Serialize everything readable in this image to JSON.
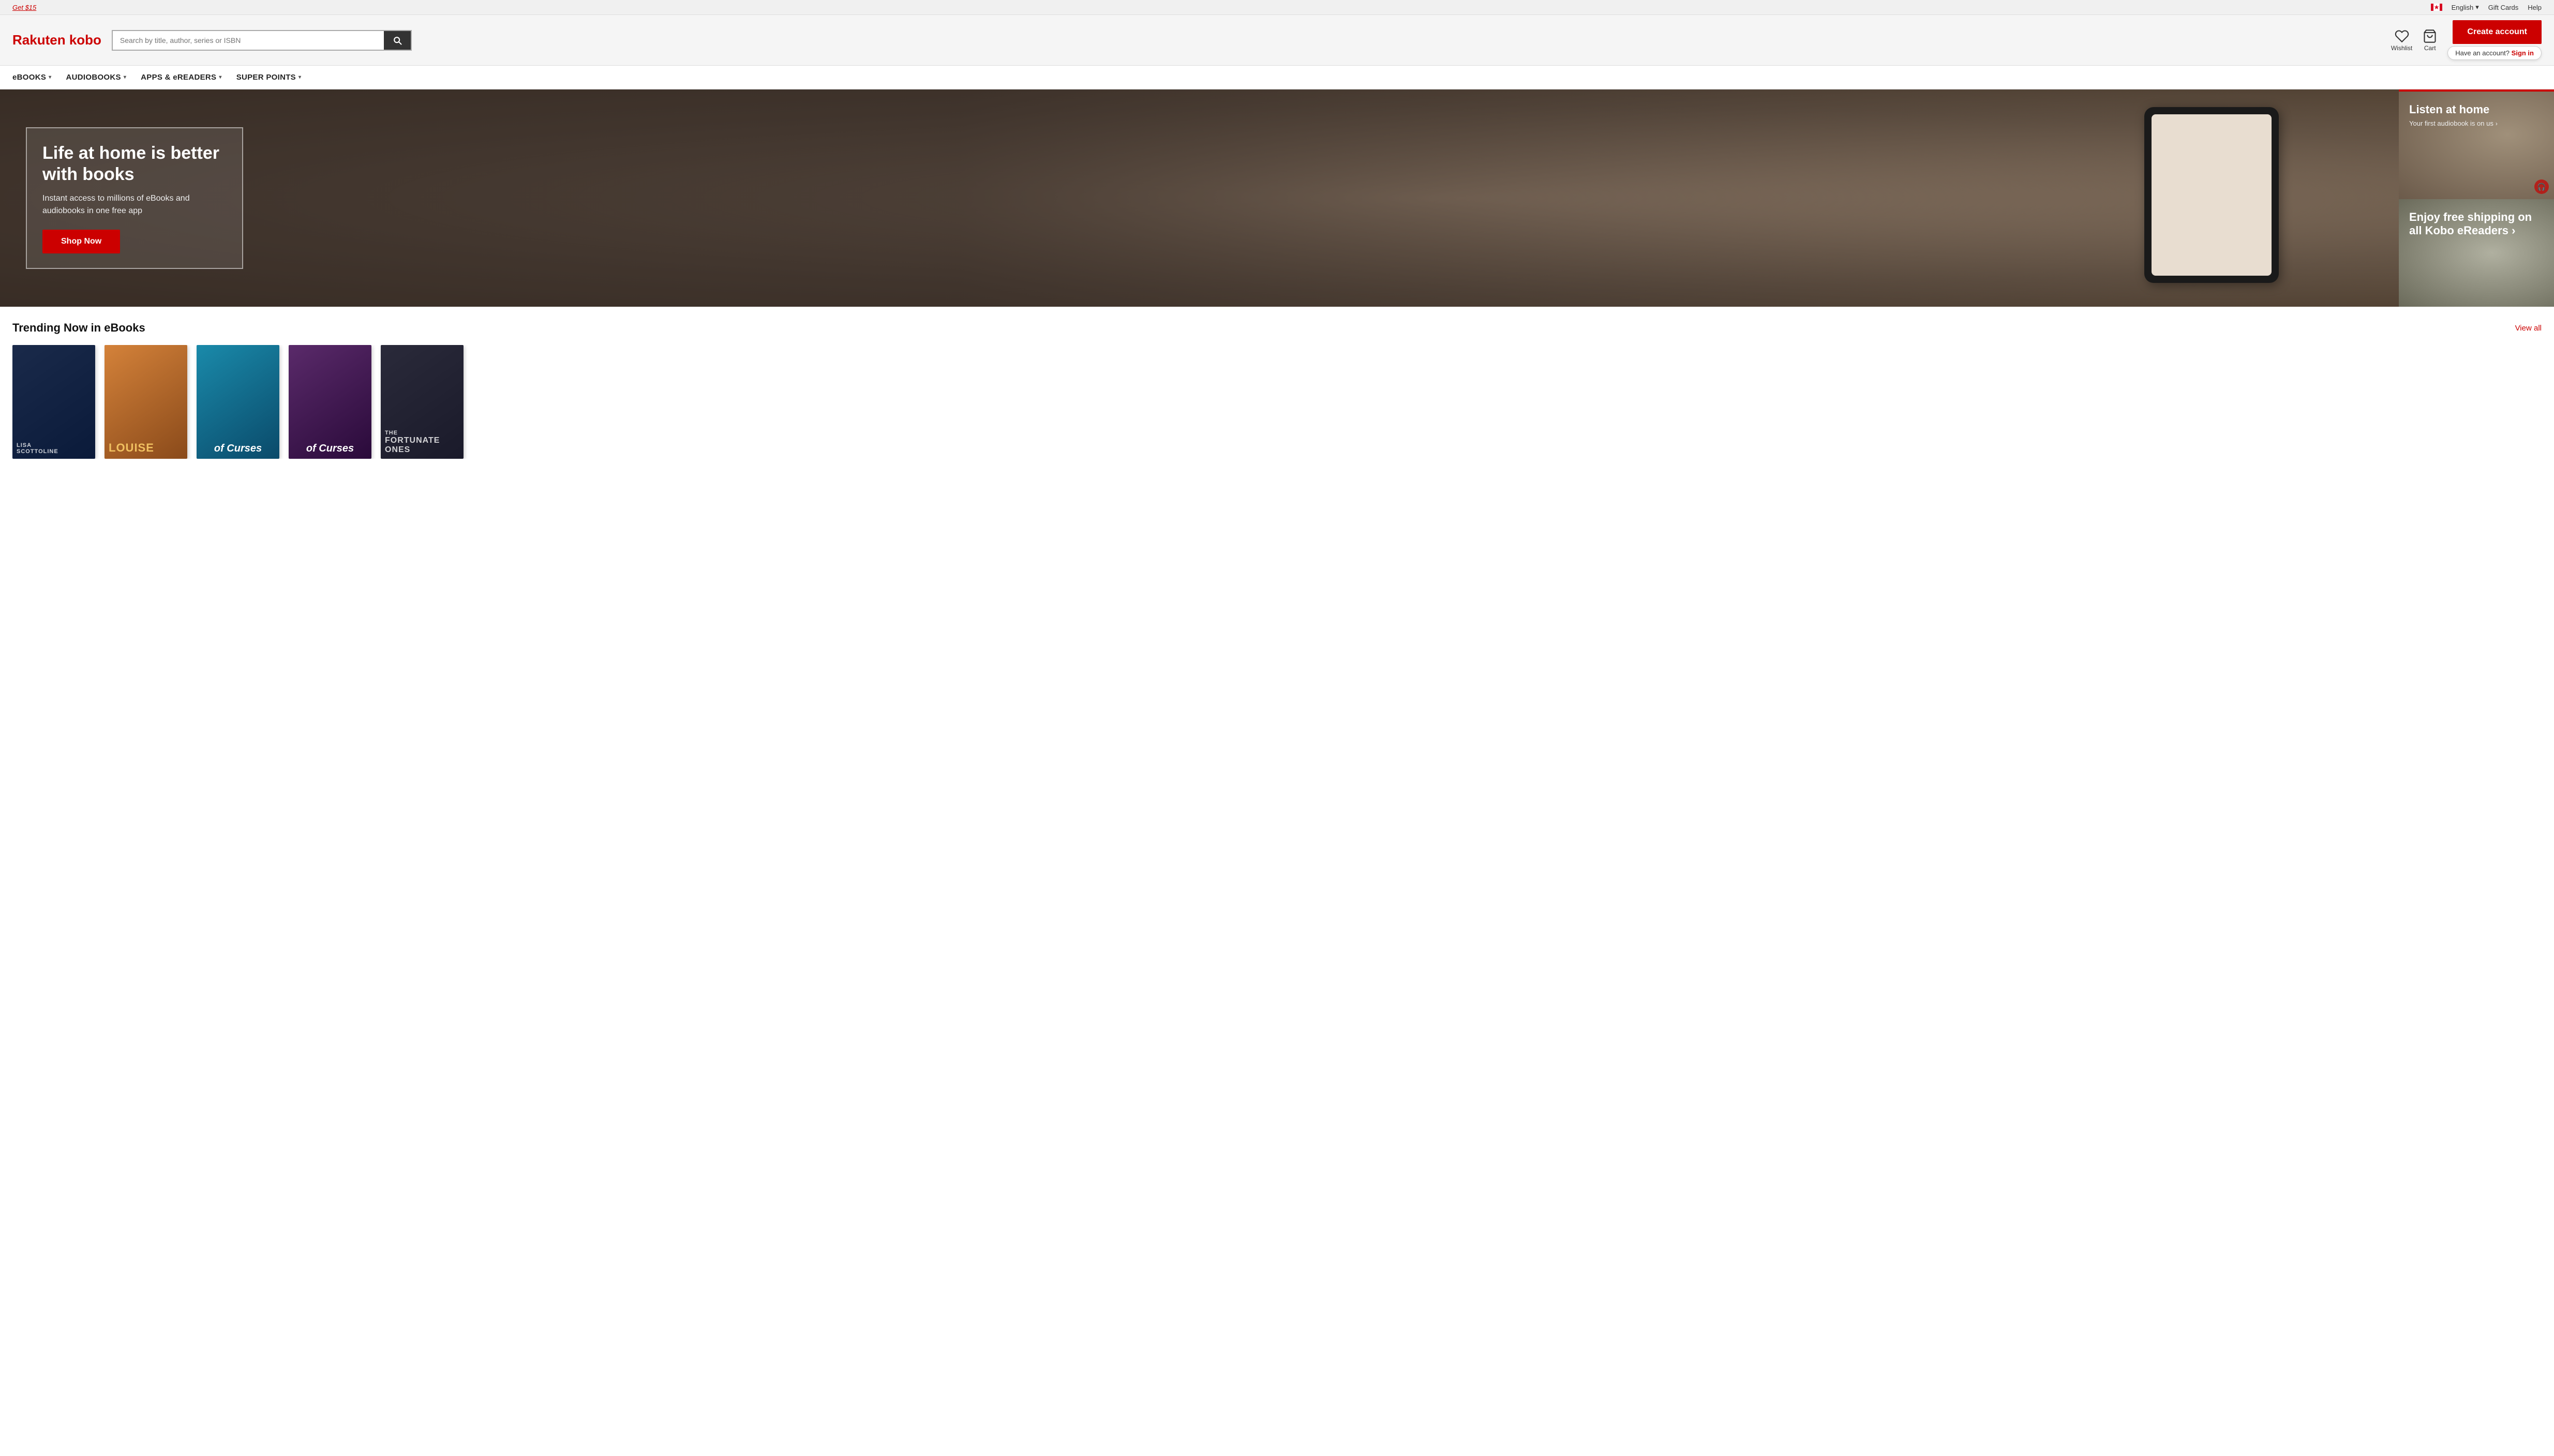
{
  "topbar": {
    "promo_text": "Get $15",
    "flag_label": "Canada flag",
    "language": "English",
    "language_dropdown_icon": "chevron-down",
    "gift_cards": "Gift Cards",
    "help": "Help"
  },
  "header": {
    "logo_rakuten": "Rakuten",
    "logo_kobo": "kobo",
    "search_placeholder": "Search by title, author, series or ISBN",
    "wishlist_label": "Wishlist",
    "cart_label": "Cart",
    "create_account": "Create account",
    "have_account": "Have an account?",
    "sign_in": "Sign in"
  },
  "nav": {
    "items": [
      {
        "label": "eBOOKS",
        "has_dropdown": true
      },
      {
        "label": "AUDIOBOOKS",
        "has_dropdown": true
      },
      {
        "label": "APPS & eREADERS",
        "has_dropdown": true
      },
      {
        "label": "SUPER POINTS",
        "has_dropdown": true
      }
    ]
  },
  "hero": {
    "main_title": "Life at home is better with books",
    "main_subtitle": "Instant access to millions of eBooks and audiobooks in one free app",
    "cta_button": "Shop Now",
    "panel_top": {
      "title": "Listen at home",
      "subtitle": "Your first audiobook is on us"
    },
    "panel_bottom": {
      "title": "Enjoy free shipping on all Kobo eReaders",
      "title_suffix": " >"
    }
  },
  "trending": {
    "section_title": "Trending Now in eBooks",
    "view_all": "View all",
    "books": [
      {
        "author": "LISA SCOTTOLINE",
        "title": "",
        "color_class": "book-1"
      },
      {
        "author": "LOUISE",
        "title": "",
        "color_class": "book-2"
      },
      {
        "author": "",
        "title": "of Curses",
        "color_class": "book-3"
      },
      {
        "author": "",
        "title": "of Curses",
        "color_class": "book-4"
      },
      {
        "author": "the FORTUNATE ONES",
        "title": "",
        "color_class": "book-5"
      }
    ]
  }
}
